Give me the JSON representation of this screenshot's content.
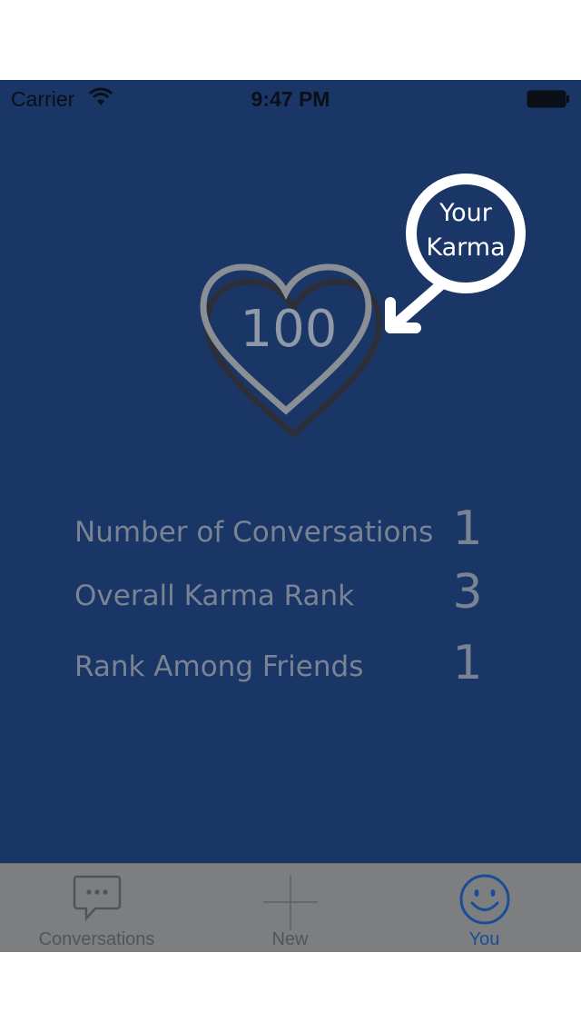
{
  "status_bar": {
    "carrier": "Carrier",
    "time": "9:47 PM"
  },
  "karma": {
    "value": "100",
    "callout_line1": "Your",
    "callout_line2": "Karma"
  },
  "stats": [
    {
      "label": "Number of Conversations",
      "value": "1"
    },
    {
      "label": "Overall Karma Rank",
      "value": "3"
    },
    {
      "label": "Rank Among Friends",
      "value": "1"
    }
  ],
  "tabs": [
    {
      "label": "Conversations",
      "icon": "chat-bubble-icon",
      "active": false
    },
    {
      "label": "New",
      "icon": "plus-icon",
      "active": false
    },
    {
      "label": "You",
      "icon": "smiley-icon",
      "active": true
    }
  ],
  "colors": {
    "background": "#1a3666",
    "tab_bar": "#7d7e80",
    "active_tab": "#1a4c97",
    "stat_text": "#7a8393"
  }
}
